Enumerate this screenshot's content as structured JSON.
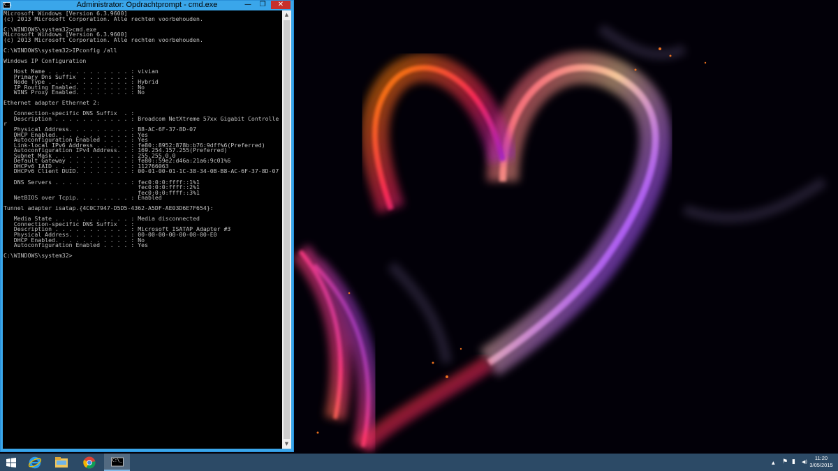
{
  "window": {
    "title": "Administrator: Opdrachtprompt - cmd.exe",
    "minimize_glyph": "—",
    "maximize_glyph": "❐",
    "close_glyph": "✕",
    "icon_label": "C:\\"
  },
  "console": {
    "lines": [
      "Microsoft Windows [Version 6.3.9600]",
      "(c) 2013 Microsoft Corporation. Alle rechten voorbehouden.",
      "",
      "C:\\WINDOWS\\system32>cmd.exe",
      "Microsoft Windows [Version 6.3.9600]",
      "(c) 2013 Microsoft Corporation. Alle rechten voorbehouden.",
      "",
      "C:\\WINDOWS\\system32>IPconfig /all",
      "",
      "Windows IP Configuration",
      "",
      "   Host Name . . . . . . . . . . . . : vivian",
      "   Primary Dns Suffix  . . . . . . . :",
      "   Node Type . . . . . . . . . . . . : Hybrid",
      "   IP Routing Enabled. . . . . . . . : No",
      "   WINS Proxy Enabled. . . . . . . . : No",
      "",
      "Ethernet adapter Ethernet 2:",
      "",
      "   Connection-specific DNS Suffix  . :",
      "   Description . . . . . . . . . . . : Broadcom NetXtreme 57xx Gigabit Controlle",
      "r",
      "   Physical Address. . . . . . . . . : B8-AC-6F-37-8D-07",
      "   DHCP Enabled. . . . . . . . . . . : Yes",
      "   Autoconfiguration Enabled . . . . : Yes",
      "   Link-local IPv6 Address . . . . . : fe80::8952:878b:b76:9dff%6(Preferred)",
      "   Autoconfiguration IPv4 Address. . : 169.254.157.255(Preferred)",
      "   Subnet Mask . . . . . . . . . . . : 255.255.0.0",
      "   Default Gateway . . . . . . . . . : fe80::59e2:d46a:21a6:9c01%6",
      "   DHCPv6 IAID . . . . . . . . . . . : 112766063",
      "   DHCPv6 Client DUID. . . . . . . . : 00-01-00-01-1C-38-34-0B-B8-AC-6F-37-8D-07",
      "",
      "   DNS Servers . . . . . . . . . . . : fec0:0:0:ffff::1%1",
      "                                       fec0:0:0:ffff::2%1",
      "                                       fec0:0:0:ffff::3%1",
      "   NetBIOS over Tcpip. . . . . . . . : Enabled",
      "",
      "Tunnel adapter isatap.{4C0C7947-D5D5-4362-A5DF-AE03D6E7F654}:",
      "",
      "   Media State . . . . . . . . . . . : Media disconnected",
      "   Connection-specific DNS Suffix  . :",
      "   Description . . . . . . . . . . . : Microsoft ISATAP Adapter #3",
      "   Physical Address. . . . . . . . . : 00-00-00-00-00-00-00-E0",
      "   DHCP Enabled. . . . . . . . . . . : No",
      "   Autoconfiguration Enabled . . . . : Yes",
      "",
      "C:\\WINDOWS\\system32>"
    ]
  },
  "scrollbar": {
    "up_glyph": "▲",
    "down_glyph": "▼"
  },
  "taskbar": {
    "pinned": [
      "start",
      "internet-explorer",
      "file-explorer",
      "chrome",
      "command-prompt"
    ],
    "cmd_icon_label": "C:\\_",
    "tray": {
      "arrow_glyph": "▲",
      "flag_glyph": "⚑",
      "net_glyph": "▮",
      "vol_glyph": "◀)"
    },
    "clock": {
      "time": "11:20",
      "date": "3/05/2015"
    }
  },
  "colors": {
    "titlebar": "#3aa6ea",
    "console_bg": "#000000",
    "console_fg": "#c0c0c0",
    "close_button": "#c7302a",
    "taskbar": "#2c4a66"
  }
}
